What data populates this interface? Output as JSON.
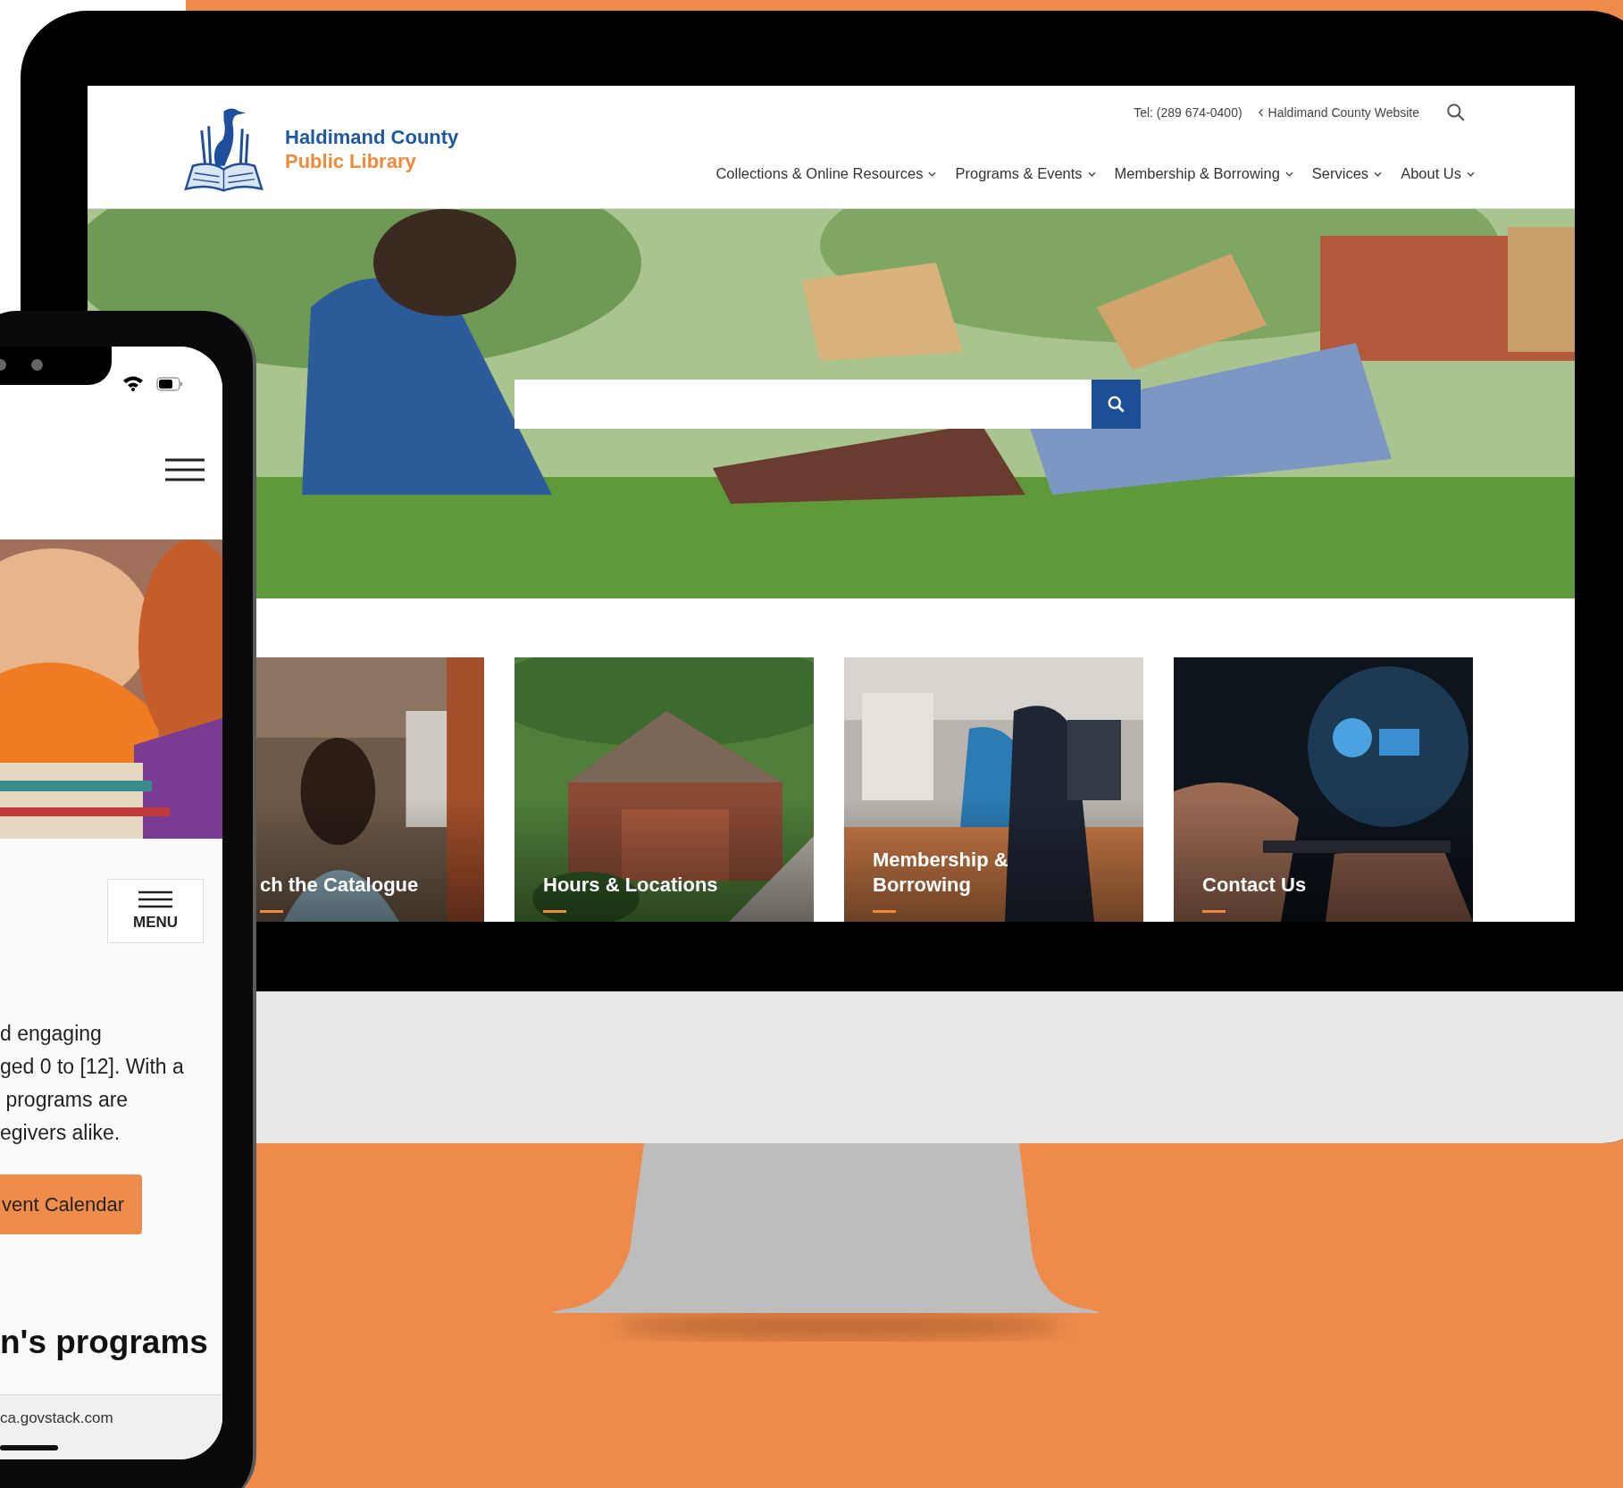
{
  "desktop": {
    "logo": {
      "line1": "Haldimand County",
      "line2": "Public Library"
    },
    "top_links": {
      "phone": "Tel: (289 674-0400)",
      "external": "Haldimand County Website"
    },
    "nav": [
      {
        "label": "Collections & Online Resources"
      },
      {
        "label": "Programs & Events"
      },
      {
        "label": "Membership & Borrowing"
      },
      {
        "label": "Services"
      },
      {
        "label": "About Us"
      }
    ],
    "cards": [
      {
        "title_lines": [
          "ch the Catalogue"
        ]
      },
      {
        "title_lines": [
          "Hours & Locations"
        ]
      },
      {
        "title_lines": [
          "Membership &",
          "Borrowing"
        ]
      },
      {
        "title_lines": [
          "Contact Us"
        ]
      }
    ]
  },
  "phone": {
    "menu_button": "MENU",
    "paragraph_lines": [
      "d engaging",
      "ged 0 to [12]. With a",
      " programs are",
      "egivers alike."
    ],
    "cta_button": "vent Calendar",
    "heading": "n's programs",
    "url": "ca.govstack.com"
  }
}
